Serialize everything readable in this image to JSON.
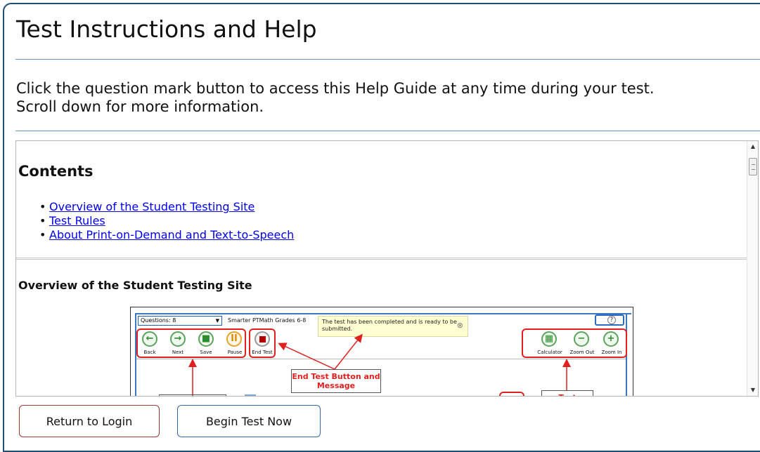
{
  "dialog": {
    "title": "Test Instructions and Help",
    "intro_line1": "Click the question mark button to access this Help Guide at any time during your test.",
    "intro_line2": "Scroll down for more information."
  },
  "help": {
    "contents_heading": "Contents",
    "contents_links": [
      "Overview of the Student Testing Site",
      "Test Rules",
      "About Print-on-Demand and Text-to-Speech"
    ],
    "section_heading": "Overview of the Student Testing Site",
    "figure": {
      "questions_label": "Questions: 8",
      "test_name": "Smarter PTMath Grades 6-8",
      "tooltip_text": "The test has been completed and is ready to be submitted.",
      "help_glyph": "?",
      "toolbar_left": [
        "Back",
        "Next",
        "Save",
        "Pause"
      ],
      "end_test_label": "End Test",
      "toolbar_right": [
        "Calculator",
        "Zoom Out",
        "Zoom In"
      ],
      "callout_end_test": "End Test Button and Message",
      "callout_test": "Test"
    }
  },
  "buttons": {
    "return_label": "Return to Login",
    "begin_label": "Begin Test Now"
  },
  "colors": {
    "accent_blue": "#1f4e79",
    "return_border": "#a33333",
    "callout_red": "#e0201e",
    "link": "#0000ee"
  },
  "icons": {
    "back": "arrow-left-icon",
    "next": "arrow-right-icon",
    "save": "save-icon",
    "pause": "pause-icon",
    "end_test": "stop-icon",
    "calculator": "calculator-icon",
    "zoom_out": "zoom-out-icon",
    "zoom_in": "zoom-in-icon"
  }
}
